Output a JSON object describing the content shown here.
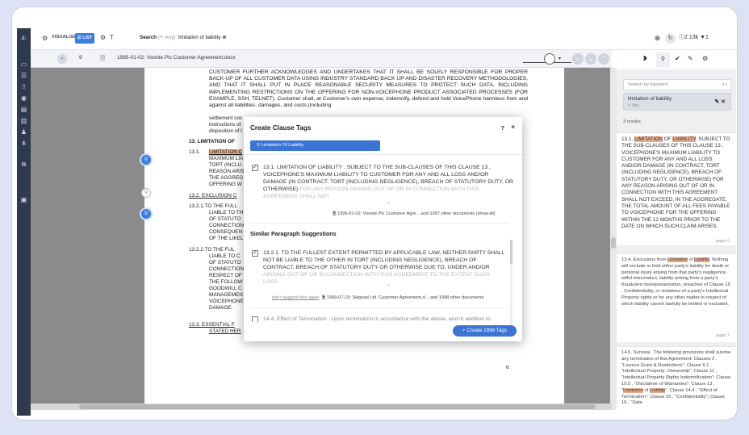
{
  "topbar": {
    "visualise_label": "VISUALISE",
    "list_label": "LIST",
    "search_prefix": "Search",
    "search_any": "(↖ Any):",
    "search_term": "limitation of liability",
    "count_label": "2.13k"
  },
  "docbar": {
    "page_number": "9",
    "doc_name": "1995-01-02: Voonte Plc Customer Agreement.docx"
  },
  "document": {
    "para1": "CUSTOMER FURTHER ACKNOWLEDGES AND UNDERTAKES THAT IT SHALL BE SOLELY RESPONSIBLE FOR PROPER BACK-UP OF ALL CUSTOMER DATA USING INDUSTRY STANDARD BACK UP AND DISASTER RECOVERY METHODOLOGIES, AND THAT IT SHALL PUT IN PLACE REASONABLE SECURITY MEASURES TO PROTECT SUCH DATA, INCLUDING IMPLEMENTING RESTRICTIONS ON THE OFFERING FOR NON-VOICEPHONE PRODUCT ASSOCIATED PROCESSES (FOR EXAMPLE, SSH, TELNET). Customer shall, at Customer's own expense, indemnify, defend and hold VoicePhone harmless from and against all liabilities, damages, and costs (including",
    "line_settle": "settlement cos",
    "line_instr": "instructions of",
    "line_disp": "disposition of t",
    "h13": "13.   LIMITATION OF",
    "c131_num": "13.1.",
    "c131_hl": "LIMITATION C",
    "c131_l2": "MAXIMUM LIA",
    "c131_l3": "TORT (INCLU",
    "c131_l4": "REASON ARIS",
    "c131_l5": "THE AGGREG",
    "c131_l6": "OFFERING W",
    "c132": "13.2.   EXCLUSION C",
    "c1321_a": "13.2.1.TO THE FULL",
    "c1321_b": "LIABLE TO TH",
    "c1321_c": "OF STATUTO",
    "c1321_d": "CONNECTION",
    "c1321_e": "CONSEQUEN",
    "c1321_f": "OF THE LIKEL",
    "c1322_a": "13.2.2.TO THE FUL",
    "c1322_b": "LIABLE TO C",
    "c1322_c": "OF STATUTO",
    "c1322_d": "CONNECTION",
    "c1322_e": "RESPECT OF",
    "c1322_f": "THE FOLLOW",
    "c1322_g": "GOODWILL C",
    "c1322_h": "MANAGEMEN",
    "c1322_i": "VOICEPHONE",
    "c1322_j": "DAMAGE.",
    "c133_a": "13.3.   ESSENTIAL F",
    "c133_b": "STATED HER",
    "page_number": "6"
  },
  "modal": {
    "title": "Create Clause Tags",
    "help": "?",
    "close": "×",
    "tag_label": "Limitation Of Liability",
    "item1_text": "13.1. LIMITATION OF LIABILITY . SUBJECT TO THE SUB-CLAUSES OF THIS CLAUSE 13 , VOICEPHONE'S MAXIMUM LIABILITY TO CUSTOMER FOR ANY AND ALL LOSS AND/OR DAMAGE (IN CONTRACT, TORT (INCLUDING NEGLIGENCE), BREACH OF STATUTORY DUTY, OR OTHERWISE)",
    "item1_fade": "FOR ANY REASON ARISING OUT OF OR IN CONNECTION WITH THIS AGREEMENT SHALL NOT",
    "item1_source": "1995-01-02: Voonte Plc Customer Agre...  and 1997 other documents (show all)",
    "section_title": "Similar Paragraph Suggestions",
    "item2_text": "13.2.1. TO THE FULLEST EXTENT PERMITTED BY APPLICABLE LAW, NEITHER PARTY SHALL NOT BE LIABLE TO THE OTHER IN TORT (INCLUDING NEGLIGENCE), BREACH OF CONTRACT, BREACH OF STATUTORY DUTY OR OTHERWISE DUE TO, UNDER AND/OR",
    "item2_fade": "ARISING OUT OF OR IN CONNECTION WITH THIS AGREEMENT TO THE EXTENT SUCH LOSS",
    "dont_suggest": "don't suggest this again",
    "item2_source": "1999-07-19: Skippad Ltd. Customer Agreement.d...  and 1998 other documents",
    "item3_text": "14.4. Effect of Termination . Upon termination in accordance with the above, and in addition to",
    "create_button": "Create 1998 Tags"
  },
  "rightpanel": {
    "search_placeholder": "Search by keyword",
    "term": "limitation of liability",
    "term_any": "↖ Any",
    "results": "3 results",
    "card1_hl1": "LIMITATION",
    "card1_of": "OF",
    "card1_hl2": "LIABILITY",
    "card1_pre": "13.1.",
    "card1_rest": ". SUBJECT TO THE SUB-CLAUSES OF THIS CLAUSE 13 , VOICEPHONE'S MAXIMUM LIABILITY TO CUSTOMER FOR ANY AND ALL LOSS AND/OR DAMAGE (IN CONTRACT, TORT (INCLUDING NEGLIGENCE), BREACH OF STATUTORY DUTY, OR OTHERWISE) FOR ANY REASON ARISING OUT OF OR IN CONNECTION WITH THIS AGREEMENT SHALL NOT EXCEED, IN THE AGGREGATE, THE TOTAL AMOUNT OF ALL FEES PAYABLE TO VOICEPHONE FOR THE OFFERING WITHIN THE 12 MONTHS PRIOR TO THE DATE ON WHICH SUCH CLAIM ARISES.",
    "card1_page": "page 6",
    "card2_pre": "13.4. Exclusions from",
    "card2_hl1": "Limitation",
    "card2_of": "of",
    "card2_hl2": "Liability",
    "card2_rest": ". Nothing will exclude or limit either party's liability for death or personal injury arising from that party's negligence, wilful misconduct, liability arising from a party's fraudulent misrepresentation, breaches of Clause 15 , Confidentiality, or violations of a party's Intellectual Property rights or for any other matter in respect of which liability cannot lawfully be limited or excluded.",
    "card2_page": "page 7",
    "card3_pre": "14.5. Survival . The following provisions shall survive any termination of this Agreement: Clauses 2 , \"Licence Grant & Restrictions\"; Clause 6.1 , \"Intellectual Property: Ownership\"; Clause 11 , \"Intellectual Property Rights Indemnification\"; Clause 10.5 , \"Disclaimer of Warranties\"; Clause 13 , \"",
    "card3_hl1": "Limitation",
    "card3_of": "of",
    "card3_hl2": "Liability",
    "card3_rest": "\"; Clause 14.4 , \"Effect of Termination\"; Clause 15 , \"Confidentiality\"; Clause 16 , \"Data"
  }
}
